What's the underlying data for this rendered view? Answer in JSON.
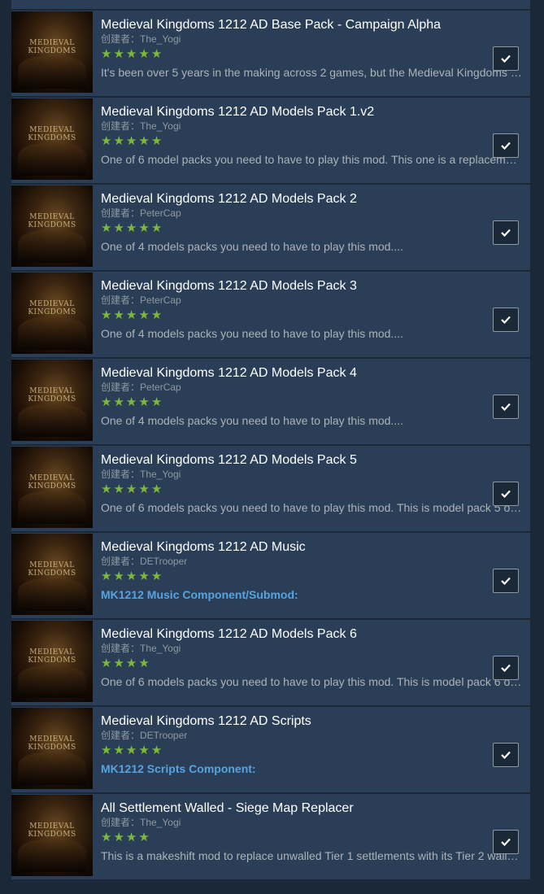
{
  "author_prefix": "创建者：",
  "star_glyph": "★",
  "items": [
    {
      "title": "Medieval Kingdoms 1212 AD Base Pack - Campaign Alpha",
      "author": "The_Yogi",
      "rating": 5,
      "description": "It's been over 5 years in the making across 2 games, but the Medieval Kingdoms …",
      "desc_style": "normal",
      "checked": true
    },
    {
      "title": "Medieval Kingdoms 1212 AD Models Pack 1.v2",
      "author": "The_Yogi",
      "rating": 5,
      "description": "One of 6 model packs you need to have to play this mod. This one is a replacem…",
      "desc_style": "normal",
      "checked": true
    },
    {
      "title": "Medieval Kingdoms 1212 AD Models Pack 2",
      "author": "PeterCap",
      "rating": 5,
      "description": "One of 4 models packs you need to have to play this mod....",
      "desc_style": "normal",
      "checked": true
    },
    {
      "title": "Medieval Kingdoms 1212 AD Models Pack 3",
      "author": "PeterCap",
      "rating": 5,
      "description": "One of 4 models packs you need to have to play this mod....",
      "desc_style": "normal",
      "checked": true
    },
    {
      "title": "Medieval Kingdoms 1212 AD Models Pack 4",
      "author": "PeterCap",
      "rating": 5,
      "description": "One of 4 models packs you need to have to play this mod....",
      "desc_style": "normal",
      "checked": true
    },
    {
      "title": "Medieval Kingdoms 1212 AD Models Pack 5",
      "author": "The_Yogi",
      "rating": 5,
      "description": "One of 6 models packs you need to have to play this mod. This is model pack 5 o…",
      "desc_style": "normal",
      "checked": true
    },
    {
      "title": "Medieval Kingdoms 1212 AD Music",
      "author": "DETrooper",
      "rating": 5,
      "description": "MK1212 Music Component/Submod:",
      "desc_style": "bold",
      "checked": true
    },
    {
      "title": "Medieval Kingdoms 1212 AD Models Pack 6",
      "author": "The_Yogi",
      "rating": 4,
      "description": "One of 6 models packs you need to have to play this mod. This is model pack 6 o…",
      "desc_style": "normal",
      "checked": true
    },
    {
      "title": "Medieval Kingdoms 1212 AD Scripts",
      "author": "DETrooper",
      "rating": 5,
      "description": "MK1212 Scripts Component:",
      "desc_style": "bold",
      "checked": true
    },
    {
      "title": "All Settlement Walled - Siege Map Replacer",
      "author": "The_Yogi",
      "rating": 4,
      "description": "This is a makeshift mod to replace unwalled Tier 1 settlements with its Tier 2 wall…",
      "desc_style": "normal",
      "checked": true
    }
  ]
}
